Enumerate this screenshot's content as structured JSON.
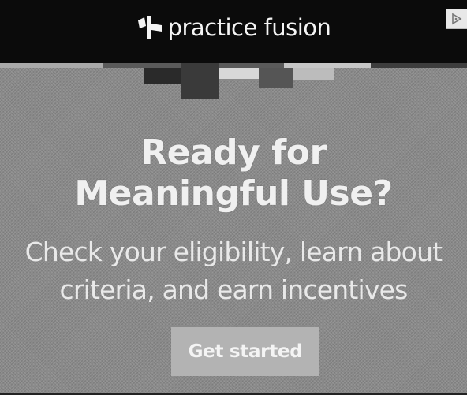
{
  "ad": {
    "brand_name": "practice fusion",
    "headline_line1": "Ready for",
    "headline_line2": "Meaningful Use?",
    "subtext_line1": "Check your eligibility, learn about",
    "subtext_line2": "criteria, and earn incentives",
    "cta_label": "Get started"
  },
  "icons": {
    "logo": "practice-fusion-logo-icon",
    "adchoices": "adchoices-icon"
  },
  "colors": {
    "background": "#8a8a8a",
    "header": "#0b0b0b",
    "text": "#f0f0f0",
    "button": "#b3b3b3"
  }
}
